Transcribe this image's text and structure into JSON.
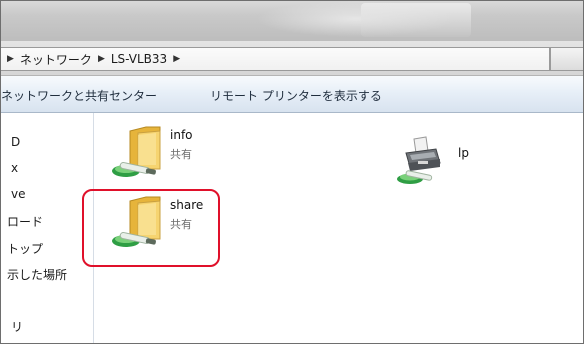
{
  "breadcrumb": {
    "items": [
      "ネットワーク",
      "LS-VLB33"
    ]
  },
  "commandbar": {
    "network_center": "ネットワークと共有センター",
    "remote_printers": "リモート プリンターを表示する"
  },
  "navpane": {
    "items": [
      "D",
      "x",
      "ve",
      "ロード",
      "トップ",
      "示した場所",
      "リ"
    ]
  },
  "content": {
    "items": [
      {
        "name": "info",
        "sub": "共有",
        "icon": "shared-folder-icon"
      },
      {
        "name": "lp",
        "sub": "",
        "icon": "network-printer-icon"
      },
      {
        "name": "share",
        "sub": "共有",
        "icon": "shared-folder-icon"
      }
    ]
  },
  "colors": {
    "highlight": "#e0102a",
    "folder": "#f0c24a",
    "share_pipe": "#2f9e44"
  }
}
